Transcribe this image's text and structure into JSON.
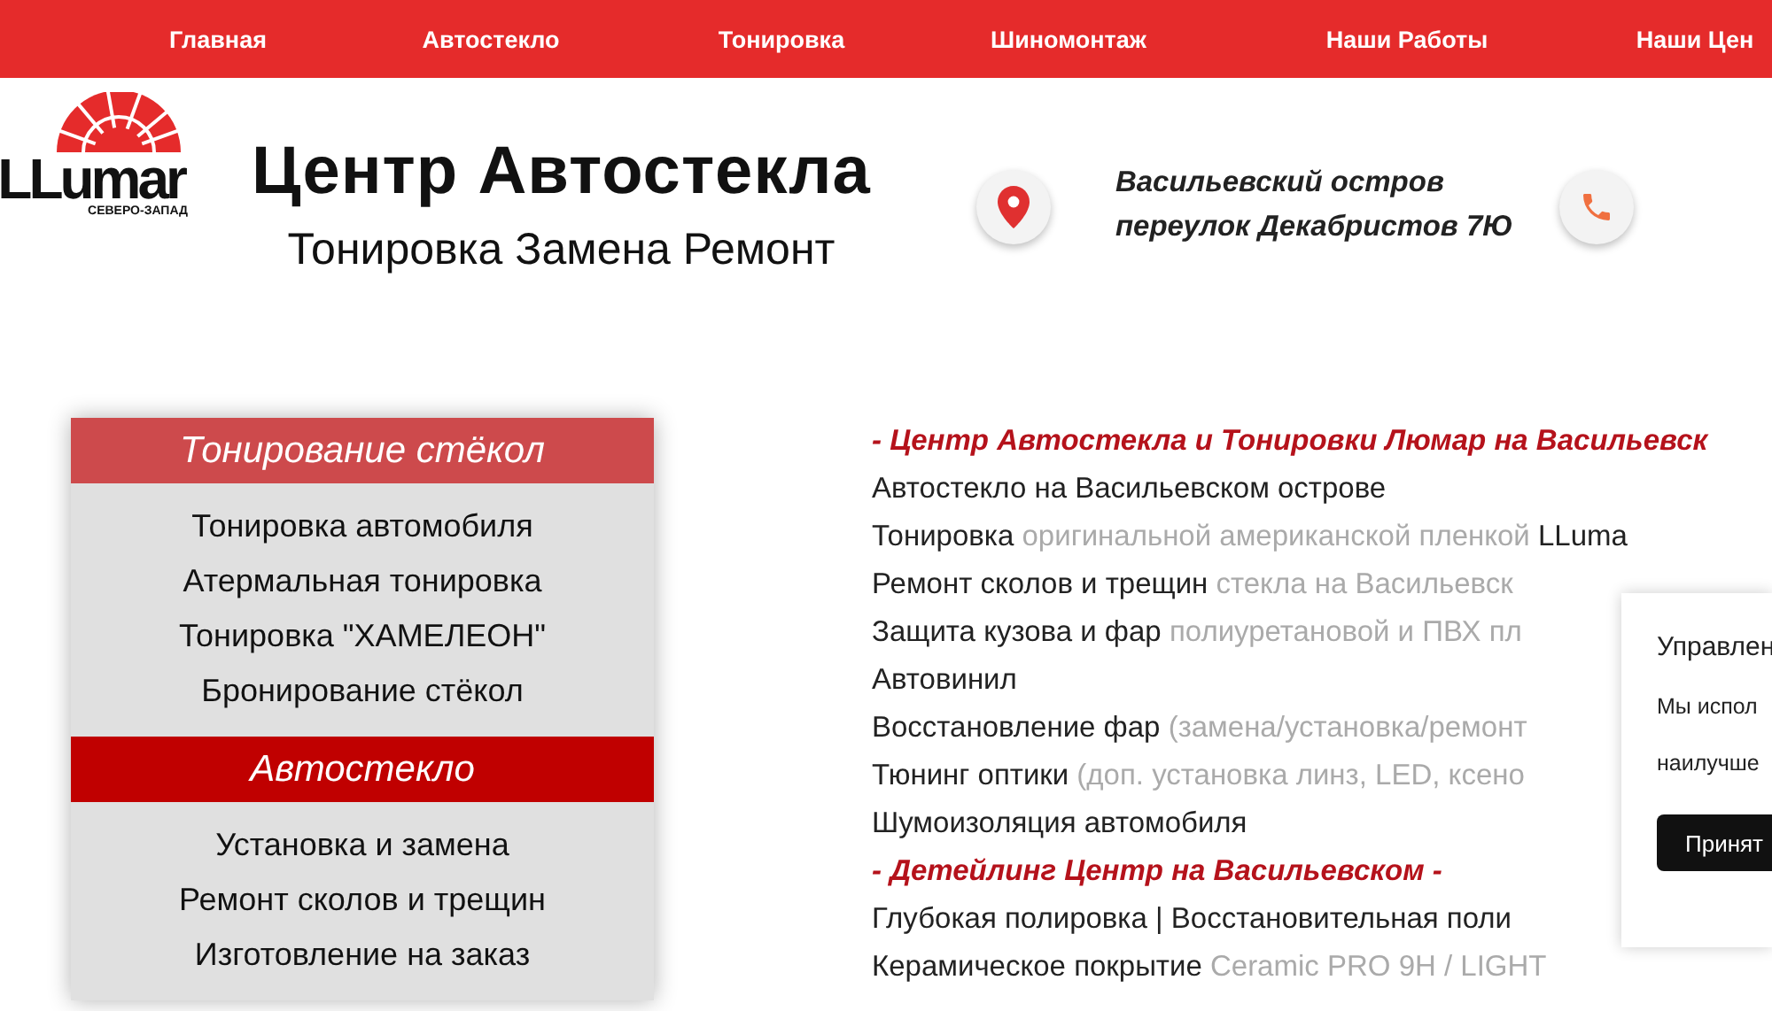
{
  "nav": [
    {
      "label": "Главная"
    },
    {
      "label": "Автостекло"
    },
    {
      "label": "Тонировка"
    },
    {
      "label": "Шиномонтаж"
    },
    {
      "label": "Наши Работы"
    },
    {
      "label": "Наши Цен"
    }
  ],
  "logo": {
    "name": "LLumar",
    "region": "СЕВЕРО-ЗАПАД"
  },
  "header": {
    "title": "Центр Автостекла",
    "subtitle": "Тонировка Замена Ремонт",
    "address": [
      "Васильевский остров",
      "переулок Декабристов 7Ю"
    ]
  },
  "sidebar": [
    {
      "title": "Тонирование стёкол",
      "selected": false,
      "items": [
        "Тонировка автомобиля",
        "Атермальная тонировка",
        "Тонировка \"ХАМЕЛЕОН\"",
        "Бронирование стёкол"
      ]
    },
    {
      "title": "Автостекло",
      "selected": true,
      "items": [
        "Установка и замена",
        "Ремонт сколов и трещин",
        "Изготовление на заказ"
      ]
    }
  ],
  "content": [
    {
      "kind": "heading",
      "parts": [
        "- Центр Автостекла и Тонировки Люмар на Васильевск"
      ]
    },
    {
      "kind": "line",
      "parts": [
        "Автостекло на Васильевском острове"
      ]
    },
    {
      "kind": "line",
      "parts": [
        "Тонировка",
        "оригинальной американской пленкой",
        "LLuma"
      ]
    },
    {
      "kind": "line",
      "parts": [
        "Ремонт сколов и трещин",
        "стекла на Васильевск"
      ]
    },
    {
      "kind": "line",
      "parts": [
        "Защита кузова и фар",
        "полиуретановой и ПВХ пл"
      ]
    },
    {
      "kind": "line",
      "parts": [
        "Автовинил"
      ]
    },
    {
      "kind": "line",
      "parts": [
        "Восстановление фар",
        "(замена/установка/ремонт"
      ]
    },
    {
      "kind": "line",
      "parts": [
        "Тюнинг оптики",
        "(доп. установка линз, LED, ксено"
      ]
    },
    {
      "kind": "line",
      "parts": [
        "Шумоизоляция автомобиля"
      ]
    },
    {
      "kind": "heading",
      "parts": [
        "- Детейлинг Центр на Васильевском -"
      ]
    },
    {
      "kind": "line",
      "parts": [
        "Глубокая полировка | Восстановительная поли"
      ]
    },
    {
      "kind": "line",
      "parts": [
        "Керамическое покрытие",
        "Ceramic PRO 9H / LIGHT"
      ]
    }
  ],
  "cookie": {
    "title": "Управлен",
    "text": [
      "Мы испол",
      "наилучше"
    ],
    "button": "Принят"
  }
}
